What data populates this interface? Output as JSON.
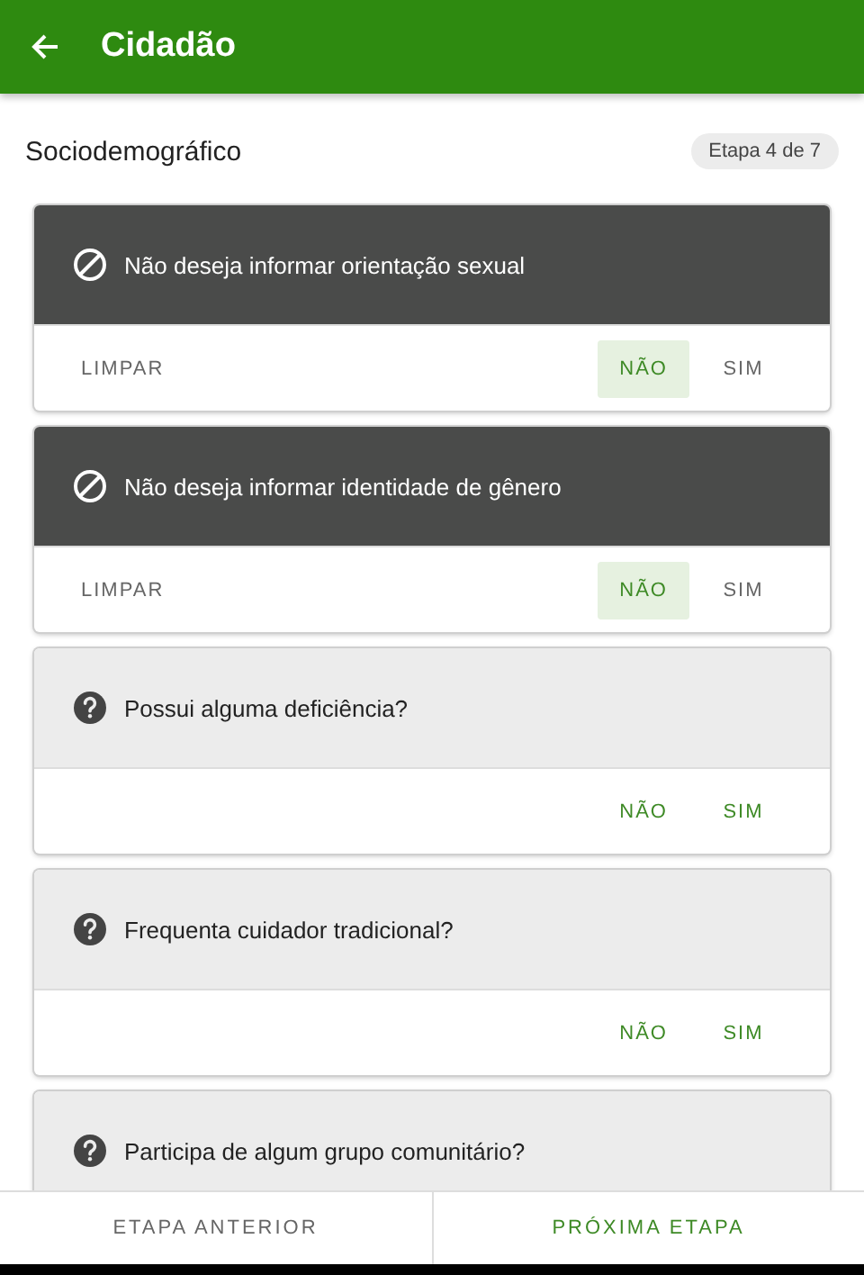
{
  "app_bar": {
    "title": "Cidadão"
  },
  "section": {
    "title": "Sociodemográfico",
    "step": "Etapa 4 de 7"
  },
  "questions": [
    {
      "kind": "declined",
      "text": "Não deseja informar orientação sexual",
      "clear": "LIMPAR",
      "options": [
        {
          "label": "NÃO",
          "selected": true
        },
        {
          "label": "SIM",
          "selected": false
        }
      ]
    },
    {
      "kind": "declined",
      "text": "Não deseja informar identidade de gênero",
      "clear": "LIMPAR",
      "options": [
        {
          "label": "NÃO",
          "selected": true
        },
        {
          "label": "SIM",
          "selected": false
        }
      ]
    },
    {
      "kind": "question",
      "text": "Possui alguma deficiência?",
      "options": [
        {
          "label": "NÃO",
          "selected": false
        },
        {
          "label": "SIM",
          "selected": false
        }
      ]
    },
    {
      "kind": "question",
      "text": "Frequenta cuidador tradicional?",
      "options": [
        {
          "label": "NÃO",
          "selected": false
        },
        {
          "label": "SIM",
          "selected": false
        }
      ]
    },
    {
      "kind": "question",
      "text": "Participa de algum grupo comunitário?"
    }
  ],
  "footer": {
    "previous": "ETAPA ANTERIOR",
    "next": "PRÓXIMA ETAPA"
  }
}
